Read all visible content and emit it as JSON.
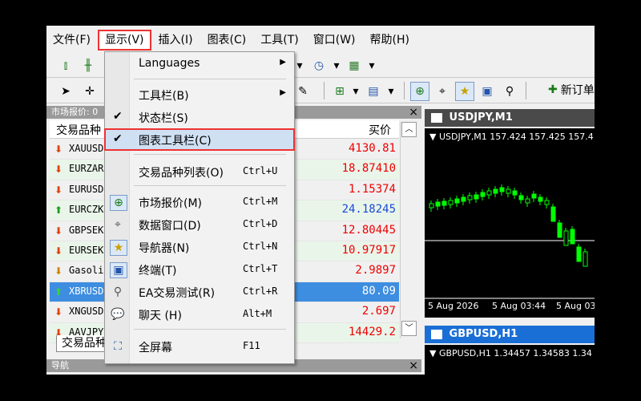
{
  "menu": [
    "文件(F)",
    "显示(V)",
    "插入(I)",
    "图表(C)",
    "工具(T)",
    "窗口(W)",
    "帮助(H)"
  ],
  "toolbar": {
    "new_order": "新订单"
  },
  "market_watch": {
    "title": "市场报价: 0",
    "col_symbol": "交易品种",
    "col_ask": "买价",
    "rows": [
      {
        "symbol": "XAUUSD",
        "ask": "4130.81",
        "dir": "down"
      },
      {
        "symbol": "EURZAR",
        "ask": "18.87410",
        "dir": "down"
      },
      {
        "symbol": "EURUSD",
        "ask": "1.15374",
        "dir": "down"
      },
      {
        "symbol": "EURCZK",
        "ask": "24.18245",
        "dir": "up"
      },
      {
        "symbol": "GBPSEK",
        "ask": "12.80445",
        "dir": "down"
      },
      {
        "symbol": "EURSEK",
        "ask": "10.97917",
        "dir": "down"
      },
      {
        "symbol": "Gasoline",
        "ask": "2.9897",
        "dir": "down"
      },
      {
        "symbol": "XBRUSD",
        "ask": "80.09",
        "dir": "up"
      },
      {
        "symbol": "XNGUSD",
        "ask": "2.697",
        "dir": "down"
      },
      {
        "symbol": "AAVJPY",
        "ask": "14429.2",
        "dir": "down"
      }
    ],
    "tab": "交易品种"
  },
  "navigator": {
    "title": "导航"
  },
  "charts": [
    {
      "tab_title": "USDJPY,M1",
      "info": "▼ USDJPY,M1 157.424 157.425 157.4",
      "time_labels": [
        "5 Aug 2026",
        "5 Aug 03:44",
        "5 Aug 03"
      ]
    },
    {
      "tab_title": "GBPUSD,H1",
      "info": "▼ GBPUSD,H1 1.34457 1.34583 1.34"
    }
  ],
  "dropdown": {
    "items": [
      {
        "label": "Languages",
        "shortcut": "",
        "submenu": true,
        "checked": false,
        "icon": ""
      },
      {
        "label": "工具栏(B)",
        "shortcut": "",
        "submenu": true,
        "checked": false,
        "icon": ""
      },
      {
        "label": "状态栏(S)",
        "shortcut": "",
        "submenu": false,
        "checked": true,
        "icon": ""
      },
      {
        "label": "图表工具栏(C)",
        "shortcut": "",
        "submenu": false,
        "checked": true,
        "icon": "",
        "highlight": true
      },
      {
        "label": "交易品种列表(O)",
        "shortcut": "Ctrl+U",
        "submenu": false,
        "checked": false,
        "icon": ""
      },
      {
        "label": "市场报价(M)",
        "shortcut": "Ctrl+M",
        "submenu": false,
        "checked": false,
        "icon": "market-watch-icon"
      },
      {
        "label": "数据窗口(D)",
        "shortcut": "Ctrl+D",
        "submenu": false,
        "checked": false,
        "icon": "crosshair-icon"
      },
      {
        "label": "导航器(N)",
        "shortcut": "Ctrl+N",
        "submenu": false,
        "checked": false,
        "icon": "navigator-star-icon"
      },
      {
        "label": "终端(T)",
        "shortcut": "Ctrl+T",
        "submenu": false,
        "checked": false,
        "icon": "terminal-icon"
      },
      {
        "label": "EA交易测试(R)",
        "shortcut": "Ctrl+R",
        "submenu": false,
        "checked": false,
        "icon": "tester-icon"
      },
      {
        "label": "聊天 (H)",
        "shortcut": "Alt+M",
        "submenu": false,
        "checked": false,
        "icon": "chat-icon"
      },
      {
        "label": "全屏幕",
        "shortcut": "F11",
        "submenu": false,
        "checked": false,
        "icon": "fullscreen-icon"
      }
    ]
  },
  "colors": {
    "highlight_border": "#e33333",
    "ask_red": "#e00000",
    "selected_row": "#3d8de0",
    "candle_green": "#00ff00"
  }
}
